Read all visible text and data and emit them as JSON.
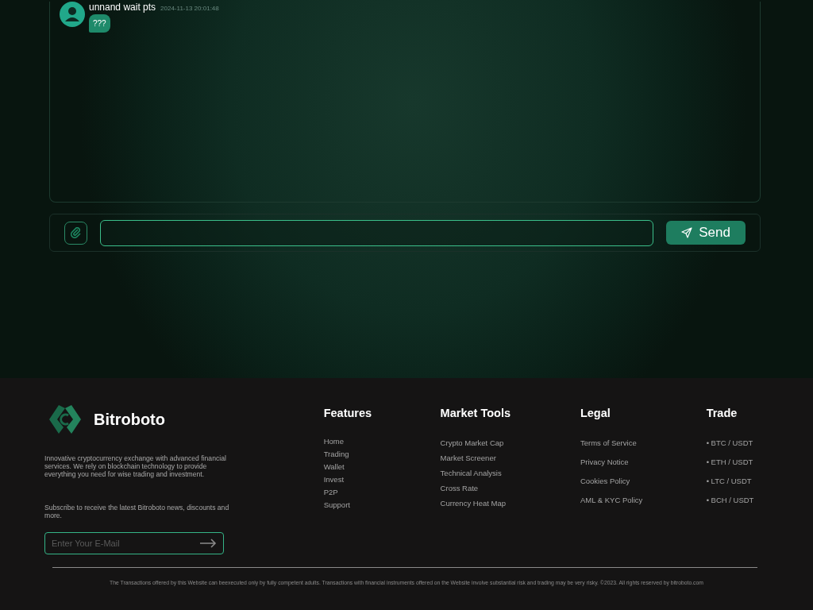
{
  "chat": {
    "messages": [
      {
        "author": "unnand wait pts",
        "time": "2024-11-13 20:01:48",
        "text": "???"
      }
    ],
    "send_button": "Send"
  },
  "footer": {
    "brand": "Bitroboto",
    "description": "Innovative cryptocurrency exchange with advanced financial services. We rely on blockchain technology to provide everything you need for wise trading and investment.",
    "subscribe_text": "Subscribe to receive the latest Bitroboto news, discounts and more.",
    "email": {
      "placeholder": "Enter Your E-Mail"
    },
    "columns": [
      {
        "title": "Features",
        "items": [
          "Home",
          "Trading",
          "Wallet",
          "Invest",
          "P2P",
          "Support"
        ]
      },
      {
        "title": "Market Tools",
        "items": [
          "Crypto Market Cap",
          "Market Screener",
          "Technical Analysis",
          "Cross Rate",
          "Currency Heat Map"
        ]
      },
      {
        "title": "Legal",
        "items": [
          "Terms of Service",
          "Privacy Notice",
          "Cookies Policy",
          "AML & KYC Policy"
        ]
      },
      {
        "title": "Trade",
        "items": [
          "• BTC / USDT",
          "• ETH / USDT",
          "• LTC / USDT",
          "• BCH / USDT"
        ]
      }
    ],
    "disclaimer": "The Transactions offered by this Website can beexecuted only by fully competent adults. Transactions with financial instruments offered on the Website involve substantial risk and trading may be very risky. ©2023. All rights reserved by bitroboto.com"
  }
}
